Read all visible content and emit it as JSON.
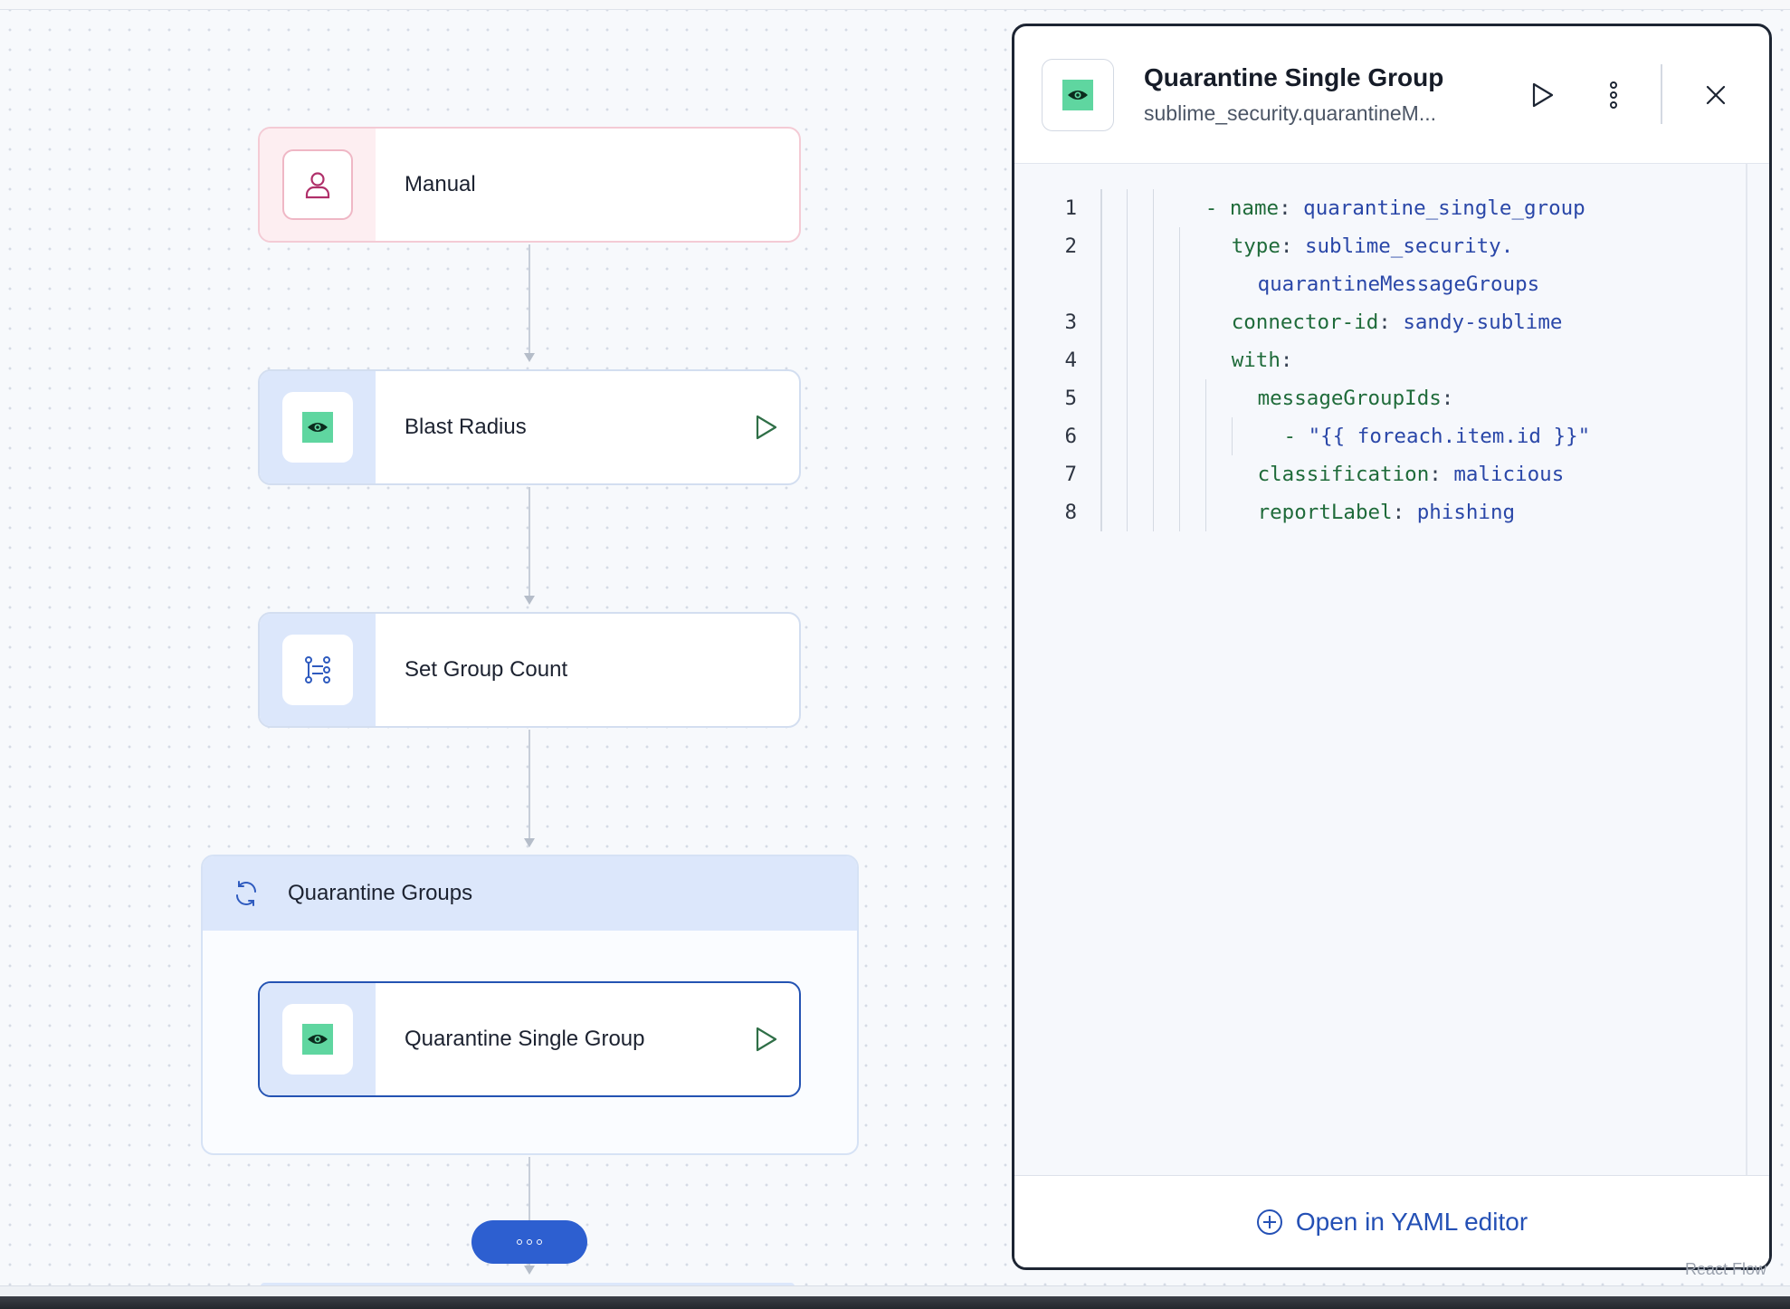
{
  "canvas": {
    "nodes": [
      {
        "id": "manual",
        "label": "Manual",
        "icon": "user-icon",
        "has_run": false
      },
      {
        "id": "blast-radius",
        "label": "Blast Radius",
        "icon": "eye-icon",
        "has_run": true
      },
      {
        "id": "set-group-count",
        "label": "Set Group Count",
        "icon": "variables-icon",
        "has_run": false
      }
    ],
    "group": {
      "label": "Quarantine Groups",
      "icon": "loop-icon",
      "child": {
        "label": "Quarantine Single Group",
        "icon": "eye-icon",
        "has_run": true,
        "selected": true
      }
    },
    "more_icon": "more-horizontal-icon",
    "attribution": "React Flow"
  },
  "panel": {
    "title": "Quarantine Single Group",
    "subtitle": "sublime_security.quarantineM...",
    "icon": "eye-icon",
    "actions": [
      "play-icon",
      "more-vertical-icon",
      "close-icon"
    ],
    "code_lines": [
      {
        "n": "1",
        "key": "- name",
        "sep": ": ",
        "val": "quarantine_single_group",
        "indent": 3
      },
      {
        "n": "2",
        "key": "type",
        "sep": ": ",
        "val": "sublime_security.",
        "indent": 4
      },
      {
        "n": "",
        "key": "",
        "sep": "",
        "val": "quarantineMessageGroups",
        "indent": 5
      },
      {
        "n": "3",
        "key": "connector-id",
        "sep": ": ",
        "val": "sandy-sublime",
        "indent": 4
      },
      {
        "n": "4",
        "key": "with",
        "sep": ":",
        "val": "",
        "indent": 4
      },
      {
        "n": "5",
        "key": "messageGroupIds",
        "sep": ":",
        "val": "",
        "indent": 5
      },
      {
        "n": "6",
        "key": "- ",
        "sep": "",
        "val": "\"{{ foreach.item.id }}\"",
        "indent": 6
      },
      {
        "n": "7",
        "key": "classification",
        "sep": ": ",
        "val": "malicious",
        "indent": 5
      },
      {
        "n": "8",
        "key": "reportLabel",
        "sep": ": ",
        "val": "phishing",
        "indent": 5
      }
    ],
    "footer_link": "Open in YAML editor",
    "footer_icon": "plus-circle-icon"
  },
  "colors": {
    "accent": "#2d5fd0",
    "node_icon_bg": "#dce7fb",
    "brand_green": "#5fd6a0",
    "yaml_key": "#1f6b3a",
    "yaml_value": "#2a47a8"
  }
}
